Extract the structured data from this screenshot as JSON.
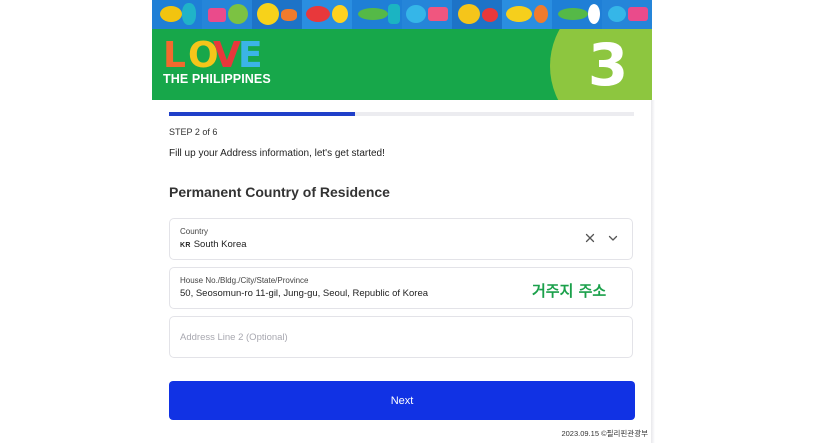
{
  "brand": {
    "logo_word": "LOVE",
    "logo_subtitle": "THE PHILIPPINES",
    "header_step_number": "3"
  },
  "progress": {
    "step_label": "STEP 2 of 6",
    "fraction_complete": 0.4
  },
  "form": {
    "intro": "Fill up your Address information, let's get started!",
    "section_title": "Permanent Country of Residence",
    "country": {
      "label": "Country",
      "flag_code": "KR",
      "value": "South Korea"
    },
    "address1": {
      "label": "House No./Bldg./City/State/Province",
      "value": "50, Seosomun-ro 11-gil, Jung-gu, Seoul, Republic of Korea"
    },
    "address2": {
      "placeholder": "Address Line 2 (Optional)"
    },
    "next_label": "Next"
  },
  "annotation": "거주지 주소",
  "footer_note": "2023.09.15 ©필리핀관광부",
  "colors": {
    "header_green": "#17a74a",
    "circle_green": "#8dc63f",
    "primary_blue": "#1132e4",
    "progress_blue": "#1f3fc9",
    "annotation_green": "#1aa04a"
  },
  "icons": [
    "clear-icon",
    "chevron-down-icon"
  ]
}
